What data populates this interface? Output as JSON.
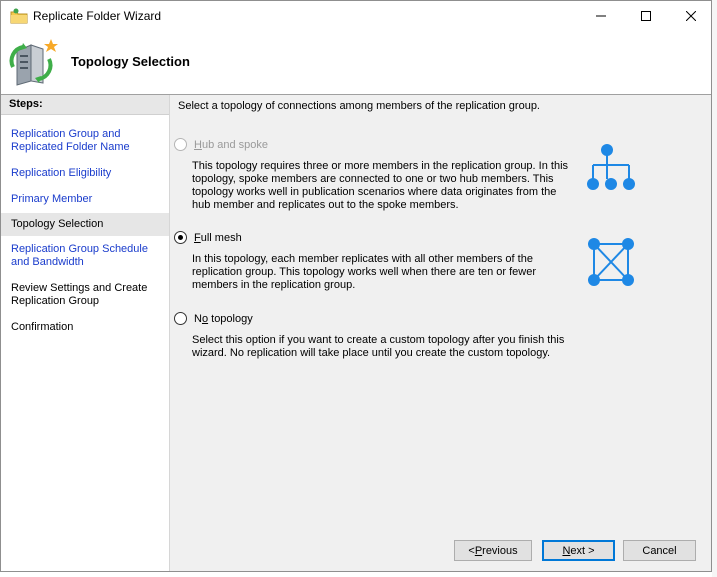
{
  "window": {
    "title": "Replicate Folder Wizard"
  },
  "header": {
    "title": "Topology Selection"
  },
  "steps": {
    "heading": "Steps:",
    "items": [
      {
        "label": "Replication Group and Replicated Folder Name",
        "state": "link"
      },
      {
        "label": "Replication Eligibility",
        "state": "link"
      },
      {
        "label": "Primary Member",
        "state": "link"
      },
      {
        "label": "Topology Selection",
        "state": "current"
      },
      {
        "label": "Replication Group Schedule and Bandwidth",
        "state": "link"
      },
      {
        "label": "Review Settings and Create Replication Group",
        "state": "plain"
      },
      {
        "label": "Confirmation",
        "state": "plain"
      }
    ]
  },
  "content": {
    "instruction": "Select a topology of connections among members of the replication group.",
    "options": [
      {
        "accel": "H",
        "rest": "ub and spoke",
        "checked": false,
        "disabled": true,
        "description": "This topology requires three or more members in the replication group. In this topology, spoke members are connected to one or two hub members. This topology works well in publication scenarios where data originates from the hub member and replicates out to the spoke members."
      },
      {
        "accel": "F",
        "rest": "ull mesh",
        "checked": true,
        "disabled": false,
        "description": "In this topology, each member replicates with all other members of the replication group. This topology works well when there are ten or fewer members in the replication group."
      },
      {
        "pre": "N",
        "accel": "o",
        "rest": " topology",
        "checked": false,
        "disabled": false,
        "description": "Select this option if you want to create a custom topology after you finish this wizard. No replication will take place until you create the custom topology."
      }
    ]
  },
  "buttons": {
    "previous": {
      "pre": "< ",
      "accel": "P",
      "rest": "revious"
    },
    "next": {
      "accel": "N",
      "rest": "ext >"
    },
    "cancel": "Cancel"
  },
  "colors": {
    "link": "#1a3ccc",
    "icon_blue": "#1e88e5",
    "accent": "#0078d7"
  }
}
